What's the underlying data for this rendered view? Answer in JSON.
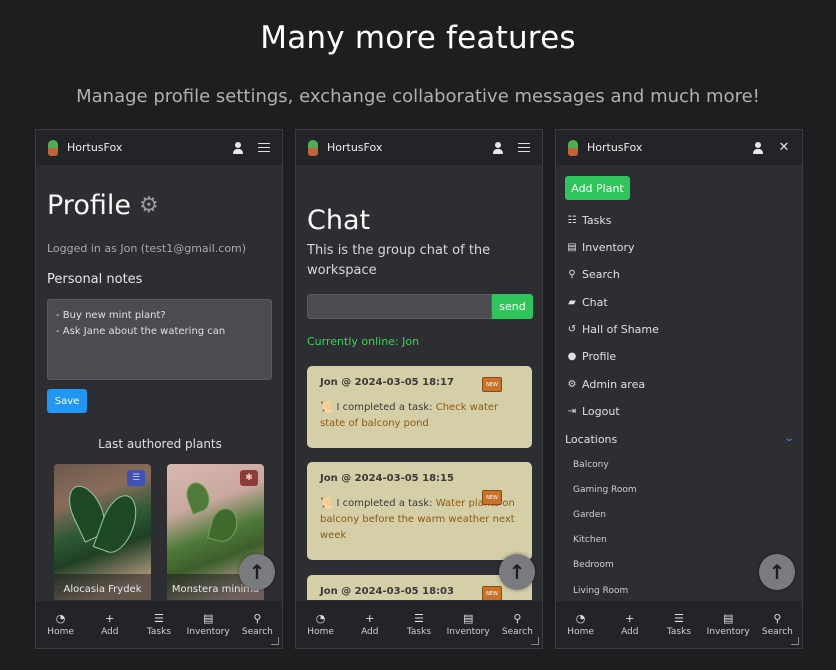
{
  "hero": {
    "title": "Many more features",
    "subtitle": "Manage profile settings, exchange collaborative messages and much more!"
  },
  "app": {
    "brand": "HortusFox"
  },
  "bottom_nav": [
    {
      "label": "Home",
      "icon": "gauge-icon",
      "glyph": "◔"
    },
    {
      "label": "Add",
      "icon": "plus-icon",
      "glyph": "+"
    },
    {
      "label": "Tasks",
      "icon": "tasks-icon",
      "glyph": "☰"
    },
    {
      "label": "Inventory",
      "icon": "warehouse-icon",
      "glyph": "▤"
    },
    {
      "label": "Search",
      "icon": "search-icon",
      "glyph": "⚲"
    }
  ],
  "profile": {
    "title": "Profile",
    "logged_in": "Logged in as Jon (test1@gmail.com)",
    "notes_label": "Personal notes",
    "notes_value": "- Buy new mint plant?\n- Ask Jane about the watering can",
    "save_label": "Save",
    "last_plants_label": "Last authored plants",
    "plants": [
      {
        "name": "Alocasia Frydek"
      },
      {
        "name": "Monstera minima"
      }
    ]
  },
  "chat": {
    "title": "Chat",
    "description": "This is the group chat of the workspace",
    "send_label": "send",
    "online": "Currently online: Jon",
    "messages": [
      {
        "head": "Jon @ 2024-03-05 18:17",
        "prefix": "I completed a task: ",
        "task": "Check water state of balcony pond",
        "badge": "NEW"
      },
      {
        "head": "Jon @ 2024-03-05 18:15",
        "prefix": "I completed a task: ",
        "task": "Water plants on balcony before the warm weather next week",
        "badge": "NEW"
      },
      {
        "head": "Jon @ 2024-03-05 18:03",
        "badge": "NEW"
      }
    ]
  },
  "menu": {
    "add_plant": "Add Plant",
    "items": [
      {
        "label": "Tasks",
        "icon": "tasks-icon"
      },
      {
        "label": "Inventory",
        "icon": "warehouse-icon"
      },
      {
        "label": "Search",
        "icon": "search-icon"
      },
      {
        "label": "Chat",
        "icon": "comments-icon"
      },
      {
        "label": "Hall of Shame",
        "icon": "history-icon"
      },
      {
        "label": "Profile",
        "icon": "user-icon"
      },
      {
        "label": "Admin area",
        "icon": "gear-icon"
      },
      {
        "label": "Logout",
        "icon": "logout-icon"
      }
    ],
    "locations_label": "Locations",
    "locations": [
      "Balcony",
      "Gaming Room",
      "Garden",
      "Kitchen",
      "Bedroom",
      "Living Room"
    ]
  },
  "colors": {
    "background": "#1e1e20",
    "panel": "#2c2e31",
    "accent_green": "#2ec55a",
    "accent_blue": "#2196f3",
    "online_green": "#3bd35b",
    "message_bg": "#d5cfa8"
  }
}
